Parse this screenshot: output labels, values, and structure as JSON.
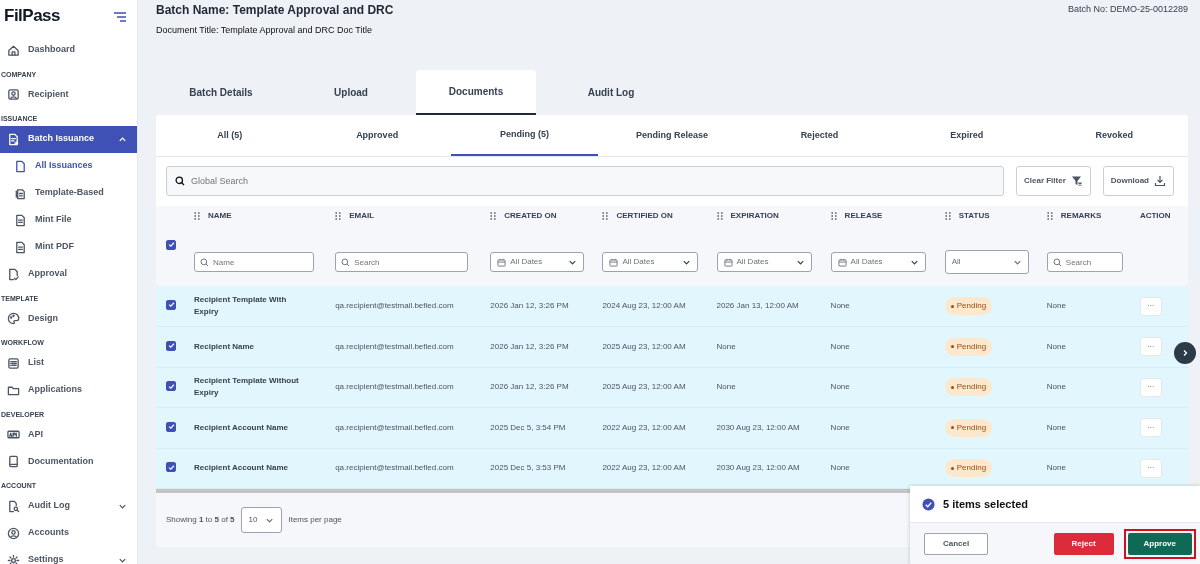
{
  "sidebar": {
    "logo": "FilPass",
    "items": [
      {
        "kind": "item",
        "label": "Dashboard"
      },
      {
        "kind": "heading",
        "label": "COMPANY"
      },
      {
        "kind": "item",
        "label": "Recipient"
      },
      {
        "kind": "heading",
        "label": "ISSUANCE"
      },
      {
        "kind": "item",
        "label": "Batch Issuance",
        "selected": true,
        "expanded": true,
        "children": [
          {
            "label": "All Issuances",
            "selected": true
          },
          {
            "label": "Template-Based",
            "selected": false
          },
          {
            "label": "Mint File",
            "selected": false
          },
          {
            "label": "Mint PDF",
            "selected": false
          }
        ]
      },
      {
        "kind": "item",
        "label": "Approval"
      },
      {
        "kind": "heading",
        "label": "TEMPLATE"
      },
      {
        "kind": "item",
        "label": "Design"
      },
      {
        "kind": "heading",
        "label": "WORKFLOW"
      },
      {
        "kind": "item",
        "label": "List"
      },
      {
        "kind": "item",
        "label": "Applications"
      },
      {
        "kind": "heading",
        "label": "DEVELOPER"
      },
      {
        "kind": "item",
        "label": "API"
      },
      {
        "kind": "item",
        "label": "Documentation"
      },
      {
        "kind": "heading",
        "label": "ACCOUNT"
      },
      {
        "kind": "item",
        "label": "Audit Log",
        "expanded": false
      },
      {
        "kind": "item",
        "label": "Accounts"
      },
      {
        "kind": "item",
        "label": "Settings",
        "expanded": false
      }
    ]
  },
  "header": {
    "batch_name": "Batch Name: Template Approval and DRC",
    "document_title": "Document Title: Template Approval and DRC Doc Title",
    "batch_no": "Batch No: DEMO-25-0012289"
  },
  "tabs": [
    {
      "label": "Batch Details",
      "selected": false
    },
    {
      "label": "Upload",
      "selected": false
    },
    {
      "label": "Documents",
      "selected": true
    },
    {
      "label": "Audit Log",
      "selected": false
    }
  ],
  "status_tabs": [
    {
      "label": "All (5)",
      "selected": false
    },
    {
      "label": "Approved",
      "selected": false
    },
    {
      "label": "Pending (5)",
      "selected": true
    },
    {
      "label": "Pending Release",
      "selected": false
    },
    {
      "label": "Rejected",
      "selected": false
    },
    {
      "label": "Expired",
      "selected": false
    },
    {
      "label": "Revoked",
      "selected": false
    }
  ],
  "toolbar": {
    "search": {
      "placeholder": "Global Search"
    },
    "buttons": [
      "Clear Filter",
      "Download"
    ]
  },
  "table": {
    "select_all": {
      "checked": true
    },
    "columns": [
      {
        "label": "NAME",
        "filter": {
          "kind": "text",
          "placeholder": "Name"
        }
      },
      {
        "label": "EMAIL",
        "filter": {
          "kind": "text",
          "placeholder": "Search"
        }
      },
      {
        "label": "CREATED ON",
        "filter": {
          "kind": "date",
          "value": "All Dates"
        }
      },
      {
        "label": "CERTIFIED ON",
        "filter": {
          "kind": "date",
          "value": "All Dates"
        }
      },
      {
        "label": "EXPIRATION",
        "filter": {
          "kind": "date",
          "value": "All Dates"
        }
      },
      {
        "label": "RELEASE",
        "filter": {
          "kind": "date",
          "value": "All Dates"
        }
      },
      {
        "label": "STATUS",
        "filter": {
          "kind": "select",
          "value": "All"
        }
      },
      {
        "label": "REMARKS",
        "filter": {
          "kind": "text",
          "placeholder": "Search"
        }
      },
      {
        "label": "ACTION"
      }
    ],
    "rows": [
      {
        "checked": true,
        "cells": [
          "Recipient Template With Expiry",
          "qa.recipient@testmail.befied.com",
          "2026 Jan 12, 3:26 PM",
          "2024 Aug 23, 12:00 AM",
          "2026 Jan 13, 12:00 AM",
          "None",
          "Pending",
          "None",
          "···"
        ]
      },
      {
        "checked": true,
        "cells": [
          "Recipient Name",
          "qa.recipient@testmail.befied.com",
          "2026 Jan 12, 3:26 PM",
          "2025 Aug 23, 12:00 AM",
          "None",
          "None",
          "Pending",
          "None",
          "···"
        ]
      },
      {
        "checked": true,
        "cells": [
          "Recipient Template Without Expiry",
          "qa.recipient@testmail.befied.com",
          "2026 Jan 12, 3:26 PM",
          "2025 Aug 23, 12:00 AM",
          "None",
          "None",
          "Pending",
          "None",
          "···"
        ]
      },
      {
        "checked": true,
        "cells": [
          "Recipient Account Name",
          "qa.recipient@testmail.befied.com",
          "2025 Dec 5, 3:54 PM",
          "2022 Aug 23, 12:00 AM",
          "2030 Aug 23, 12:00 AM",
          "None",
          "Pending",
          "None",
          "···"
        ]
      },
      {
        "checked": true,
        "cells": [
          "Recipient Account Name",
          "qa.recipient@testmail.befied.com",
          "2025 Dec 5, 3:53 PM",
          "2022 Aug 23, 12:00 AM",
          "2030 Aug 23, 12:00 AM",
          "None",
          "Pending",
          "None",
          "···"
        ]
      }
    ]
  },
  "pagination": {
    "summary": "Showing **1** to **5** of **5**",
    "page_size": "10",
    "page_size_label": "Items per page"
  },
  "selection_bar": {
    "message": "5 items selected",
    "buttons": [
      {
        "kind": "cancel",
        "label": "Cancel"
      },
      {
        "kind": "reject",
        "label": "Reject"
      },
      {
        "kind": "approve",
        "label": "Approve",
        "highlighted": true
      }
    ]
  }
}
